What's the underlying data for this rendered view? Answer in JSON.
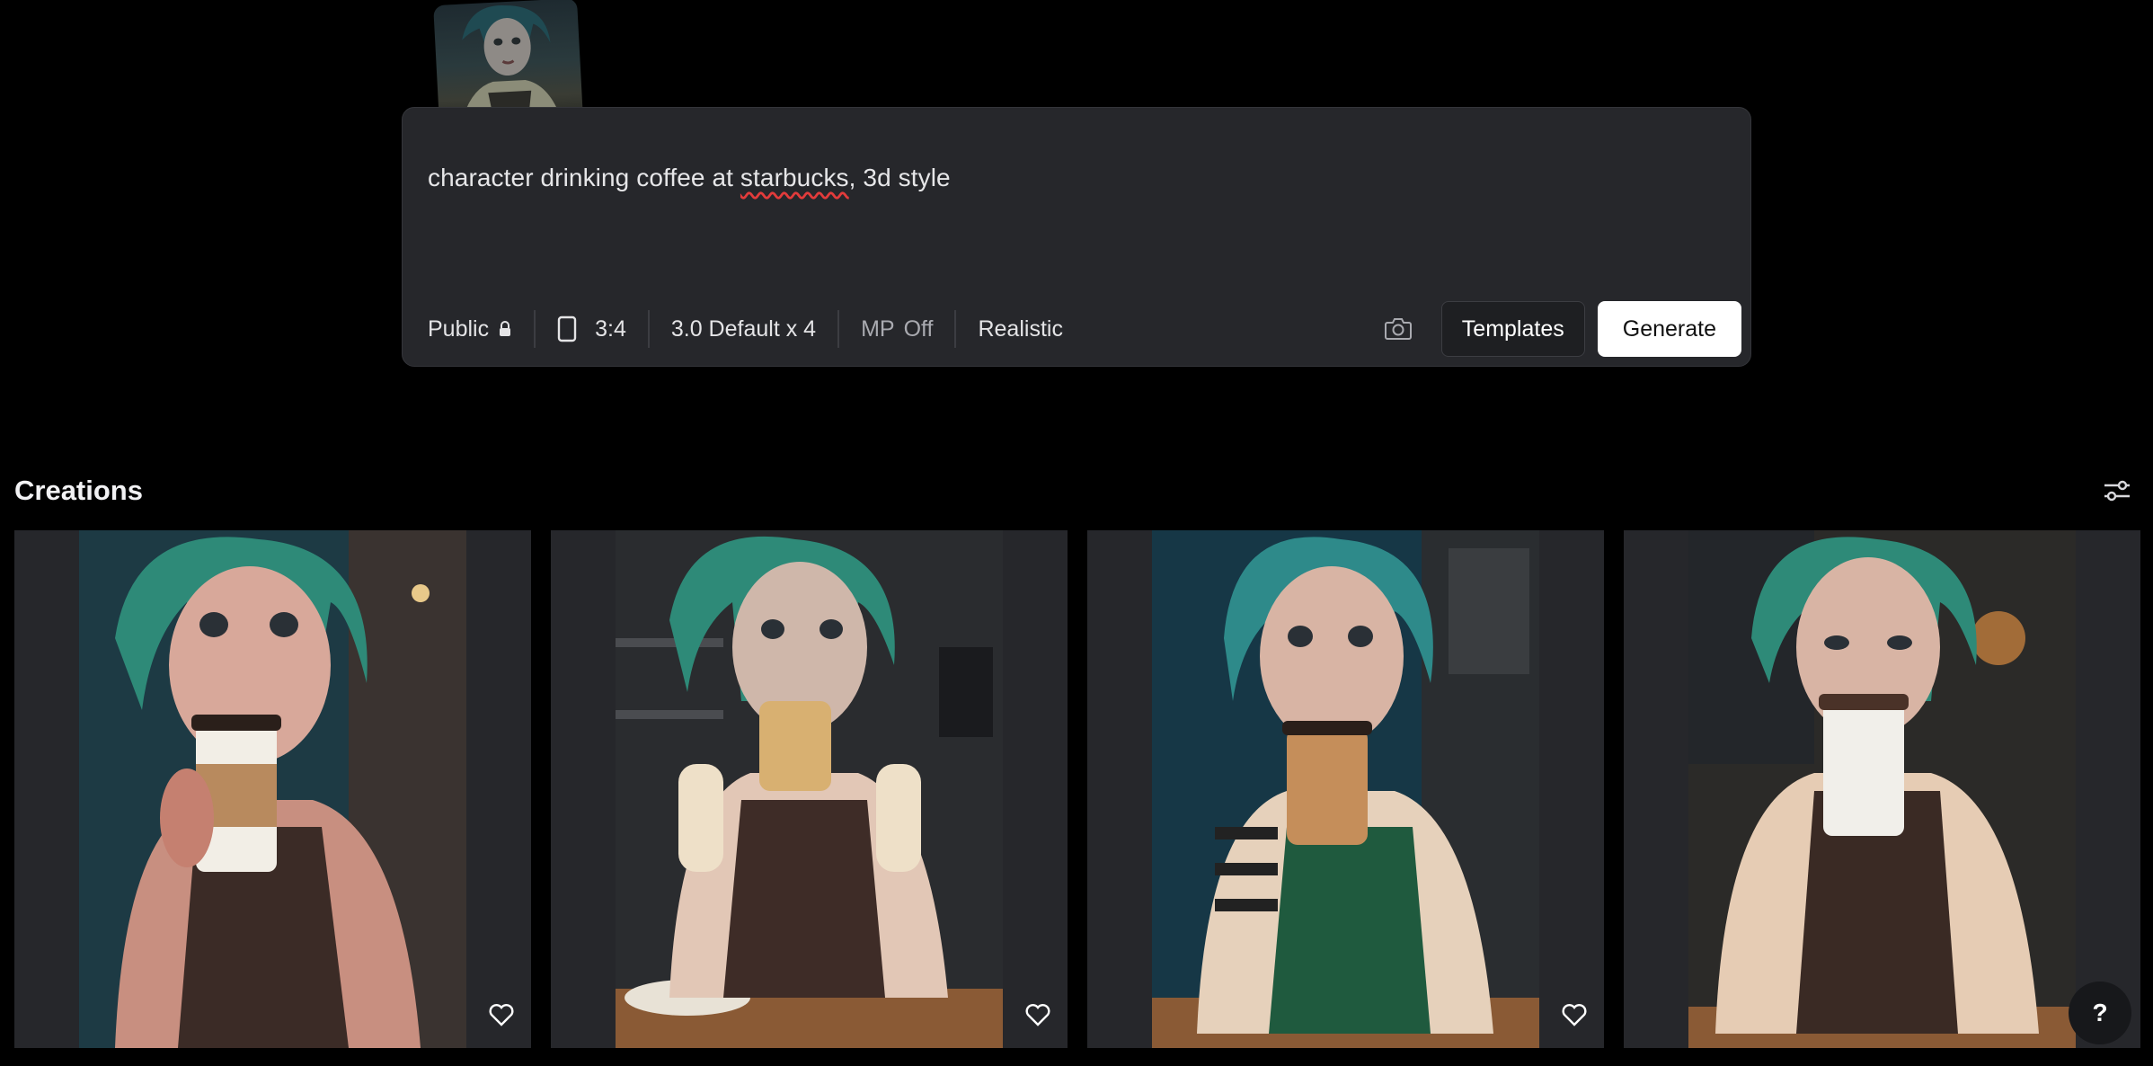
{
  "reference_image": {
    "alt_icon": "reference-image-thumbnail"
  },
  "prompt": {
    "text_before": "character drinking coffee at ",
    "text_misspelled": "starbucks",
    "text_after": ", 3d style"
  },
  "toolbar": {
    "visibility_label": "Public",
    "visibility_icon": "lock-icon",
    "aspect_ratio_icon": "portrait-frame-icon",
    "aspect_ratio": "3:4",
    "model": "3.0 Default x 4",
    "mp_label": "MP",
    "mp_value": "Off",
    "style": "Realistic",
    "camera_icon": "camera-icon",
    "templates_label": "Templates",
    "generate_label": "Generate"
  },
  "creations": {
    "title": "Creations",
    "filter_icon": "sliders-icon",
    "items": [
      {
        "apron": "#3b2b26",
        "cup": "#f2eee6",
        "sleeve": "#b88a5e",
        "bg": "#1d3a44"
      },
      {
        "apron": "#3e2c27",
        "cup": "#d8b071",
        "sleeve": "#d8b071",
        "bg": "#2a2c2f"
      },
      {
        "apron": "#1f5a3e",
        "cup": "#c58e5a",
        "sleeve": "#c58e5a",
        "bg": "#163746"
      },
      {
        "apron": "#3a2a24",
        "cup": "#f1efea",
        "sleeve": "#4a3228",
        "bg": "#2b2a28"
      }
    ]
  },
  "help_label": "?"
}
